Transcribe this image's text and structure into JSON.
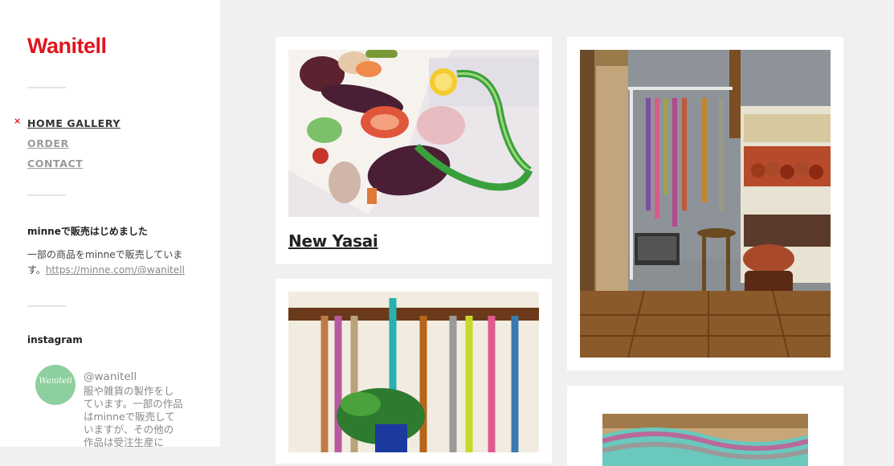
{
  "site": {
    "logo": "Wanitell"
  },
  "nav": {
    "items": [
      {
        "label": "HOME GALLERY",
        "active": true
      },
      {
        "label": "ORDER",
        "active": false
      },
      {
        "label": "CONTACT",
        "active": false
      }
    ],
    "active_marker": "×"
  },
  "widgets": {
    "minne": {
      "title": "minneで販売はじめました",
      "text": "一部の商品をminneで販売しています。",
      "link": "https://minne.com/@wanitell"
    },
    "instagram": {
      "title": "instagram",
      "avatar_text": "Wanitell",
      "handle": "@wanitell",
      "bio": "服や雑貨の製作をしています。一部の作品はminneで販売していますが、その他の作品は受注生産に"
    }
  },
  "gallery": {
    "posts": [
      {
        "title": "New Yasai",
        "image": "vegetable-print tote bag"
      },
      {
        "title": "",
        "image": "macrame plant hangers hanging in shop corner"
      },
      {
        "title": "",
        "image": "macrame plant hangers on wall"
      },
      {
        "title": "",
        "image": "macrame close-up"
      }
    ]
  },
  "colors": {
    "accent": "#e0141e",
    "background": "#f0f0f0",
    "sidebar": "#ffffff"
  }
}
